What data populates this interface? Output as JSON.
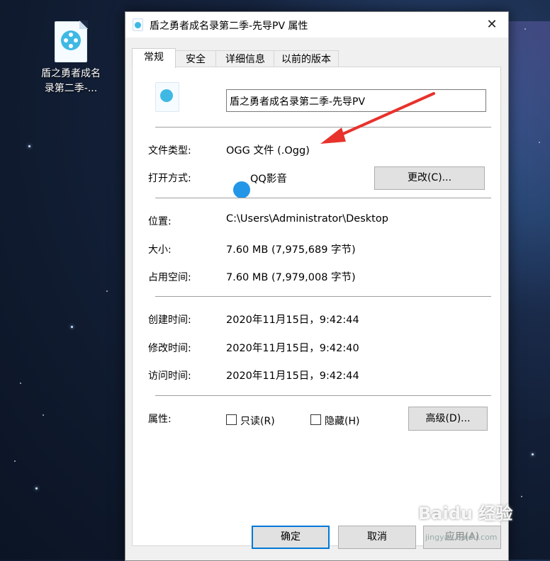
{
  "desktop": {
    "file_label": "盾之勇者成名录第二季-..."
  },
  "dialog": {
    "title": "盾之勇者成名录第二季-先导PV 属性",
    "close": "✕",
    "tabs": [
      "常规",
      "安全",
      "详细信息",
      "以前的版本"
    ],
    "file_name": "盾之勇者成名录第二季-先导PV",
    "file_type_label": "文件类型:",
    "file_type_value": "OGG 文件 (.Ogg)",
    "open_with_label": "打开方式:",
    "open_with_value": "QQ影音",
    "change_button": "更改(C)...",
    "location_label": "位置:",
    "location_value": "C:\\Users\\Administrator\\Desktop",
    "size_label": "大小:",
    "size_value": "7.60 MB (7,975,689 字节)",
    "disk_size_label": "占用空间:",
    "disk_size_value": "7.60 MB (7,979,008 字节)",
    "created_label": "创建时间:",
    "created_value": "2020年11月15日，9:42:44",
    "modified_label": "修改时间:",
    "modified_value": "2020年11月15日，9:42:40",
    "accessed_label": "访问时间:",
    "accessed_value": "2020年11月15日，9:42:44",
    "attributes_label": "属性:",
    "readonly_label": "只读(R)",
    "hidden_label": "隐藏(H)",
    "advanced_button": "高级(D)...",
    "ok_button": "确定",
    "cancel_button": "取消",
    "apply_button": "应用(A)"
  },
  "watermark": {
    "text": "Baidu 经验",
    "sub": "jingyan.baidu.com"
  },
  "colors": {
    "arrow": "#e8322c",
    "accent": "#0078d7"
  }
}
